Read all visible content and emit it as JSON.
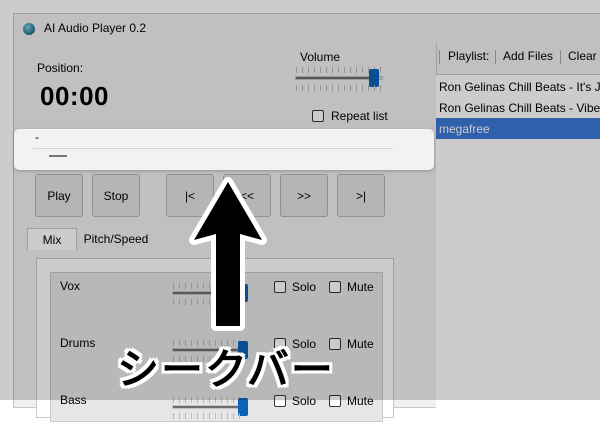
{
  "window": {
    "title": "AI Audio Player 0.2"
  },
  "position": {
    "label": "Position:",
    "time": "00:00"
  },
  "volume": {
    "label": "Volume",
    "level_fraction": 0.9
  },
  "repeat": {
    "label": "Repeat list",
    "checked": false
  },
  "seekbar": {
    "indicator": "-",
    "value_fraction": 0.0
  },
  "transport": {
    "play": "Play",
    "stop": "Stop",
    "first": "|<",
    "rewind": "<<",
    "forward": ">>",
    "last": ">|"
  },
  "tabs": [
    {
      "label": "Mix",
      "active": true
    },
    {
      "label": "Pitch/Speed",
      "active": false
    }
  ],
  "mixer": {
    "channels": [
      {
        "name": "Vox",
        "solo_label": "Solo",
        "mute_label": "Mute",
        "level_fraction": 1.0
      },
      {
        "name": "Drums",
        "solo_label": "Solo",
        "mute_label": "Mute",
        "level_fraction": 1.0
      },
      {
        "name": "Bass",
        "solo_label": "Solo",
        "mute_label": "Mute",
        "level_fraction": 1.0
      }
    ]
  },
  "playlist_toolbar": {
    "title": "Playlist:",
    "add_files": "Add Files",
    "clear": "Clear"
  },
  "playlist": {
    "items": [
      "Ron Gelinas Chill Beats - It's Just",
      "Ron Gelinas Chill Beats - Vibe",
      "megafree"
    ],
    "selected_index": 2
  },
  "annotation": {
    "caption": "シークバー"
  },
  "colors": {
    "accent": "#0a63b8",
    "selection": "#3a78d8"
  }
}
